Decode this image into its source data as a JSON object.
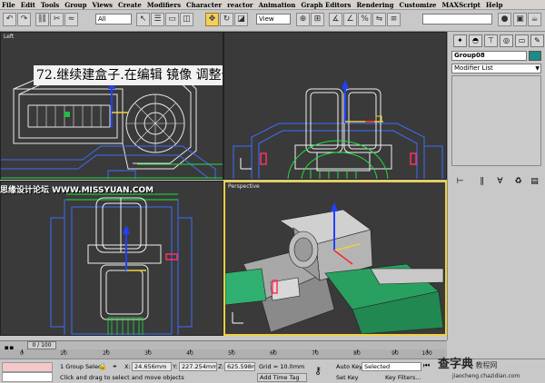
{
  "menu": [
    "File",
    "Edit",
    "Tools",
    "Group",
    "Views",
    "Create",
    "Modifiers",
    "Character",
    "reactor",
    "Animation",
    "Graph Editors",
    "Rendering",
    "Customize",
    "MAXScript",
    "Help"
  ],
  "toolbar": {
    "selection_filter": "All",
    "ref_coord": "View",
    "selection_set": "",
    "icons": [
      "undo-icon",
      "redo-icon",
      "link-icon",
      "unlink-icon",
      "bind-space-warp-icon",
      "select-icon",
      "select-by-name-icon",
      "rect-region-icon",
      "window-crossing-icon",
      "move-icon",
      "rotate-icon",
      "scale-icon"
    ]
  },
  "annotation": "72.继续建盒子.在编辑 镜像 调整位置.",
  "watermark_left": "思缘设计论坛  WWW.MISSYUAN.COM",
  "viewports": {
    "top": {
      "label": "Left"
    },
    "front": {
      "label": ""
    },
    "left": {
      "label": ""
    },
    "perspective": {
      "label": "Perspective"
    }
  },
  "command_panel": {
    "object_name": "Group08",
    "object_color": "#1e8a84",
    "modifier_list": "Modifier List"
  },
  "time": {
    "frame": "0 / 100",
    "ticks": [
      "0",
      "10",
      "20",
      "30",
      "40",
      "50",
      "60",
      "70",
      "80",
      "90",
      "100"
    ]
  },
  "status": {
    "selection": "1 Group Selec",
    "prompt": "Click and drag to select and move objects",
    "x_label": "X:",
    "x": "24.656mm",
    "y_label": "Y:",
    "y": "227.254mm",
    "z_label": "Z:",
    "z": "625.598mm",
    "grid": "Grid = 10.0mm",
    "add_time_tag": "Add Time Tag",
    "auto_key": "Auto Key",
    "auto_key_mode": "Selected",
    "set_key": "Set Key",
    "key_filters": "Key Filters..."
  },
  "watermark_right": {
    "brand": "查字典",
    "sub": "教程网",
    "url": "jiaocheng.chazidian.com"
  }
}
